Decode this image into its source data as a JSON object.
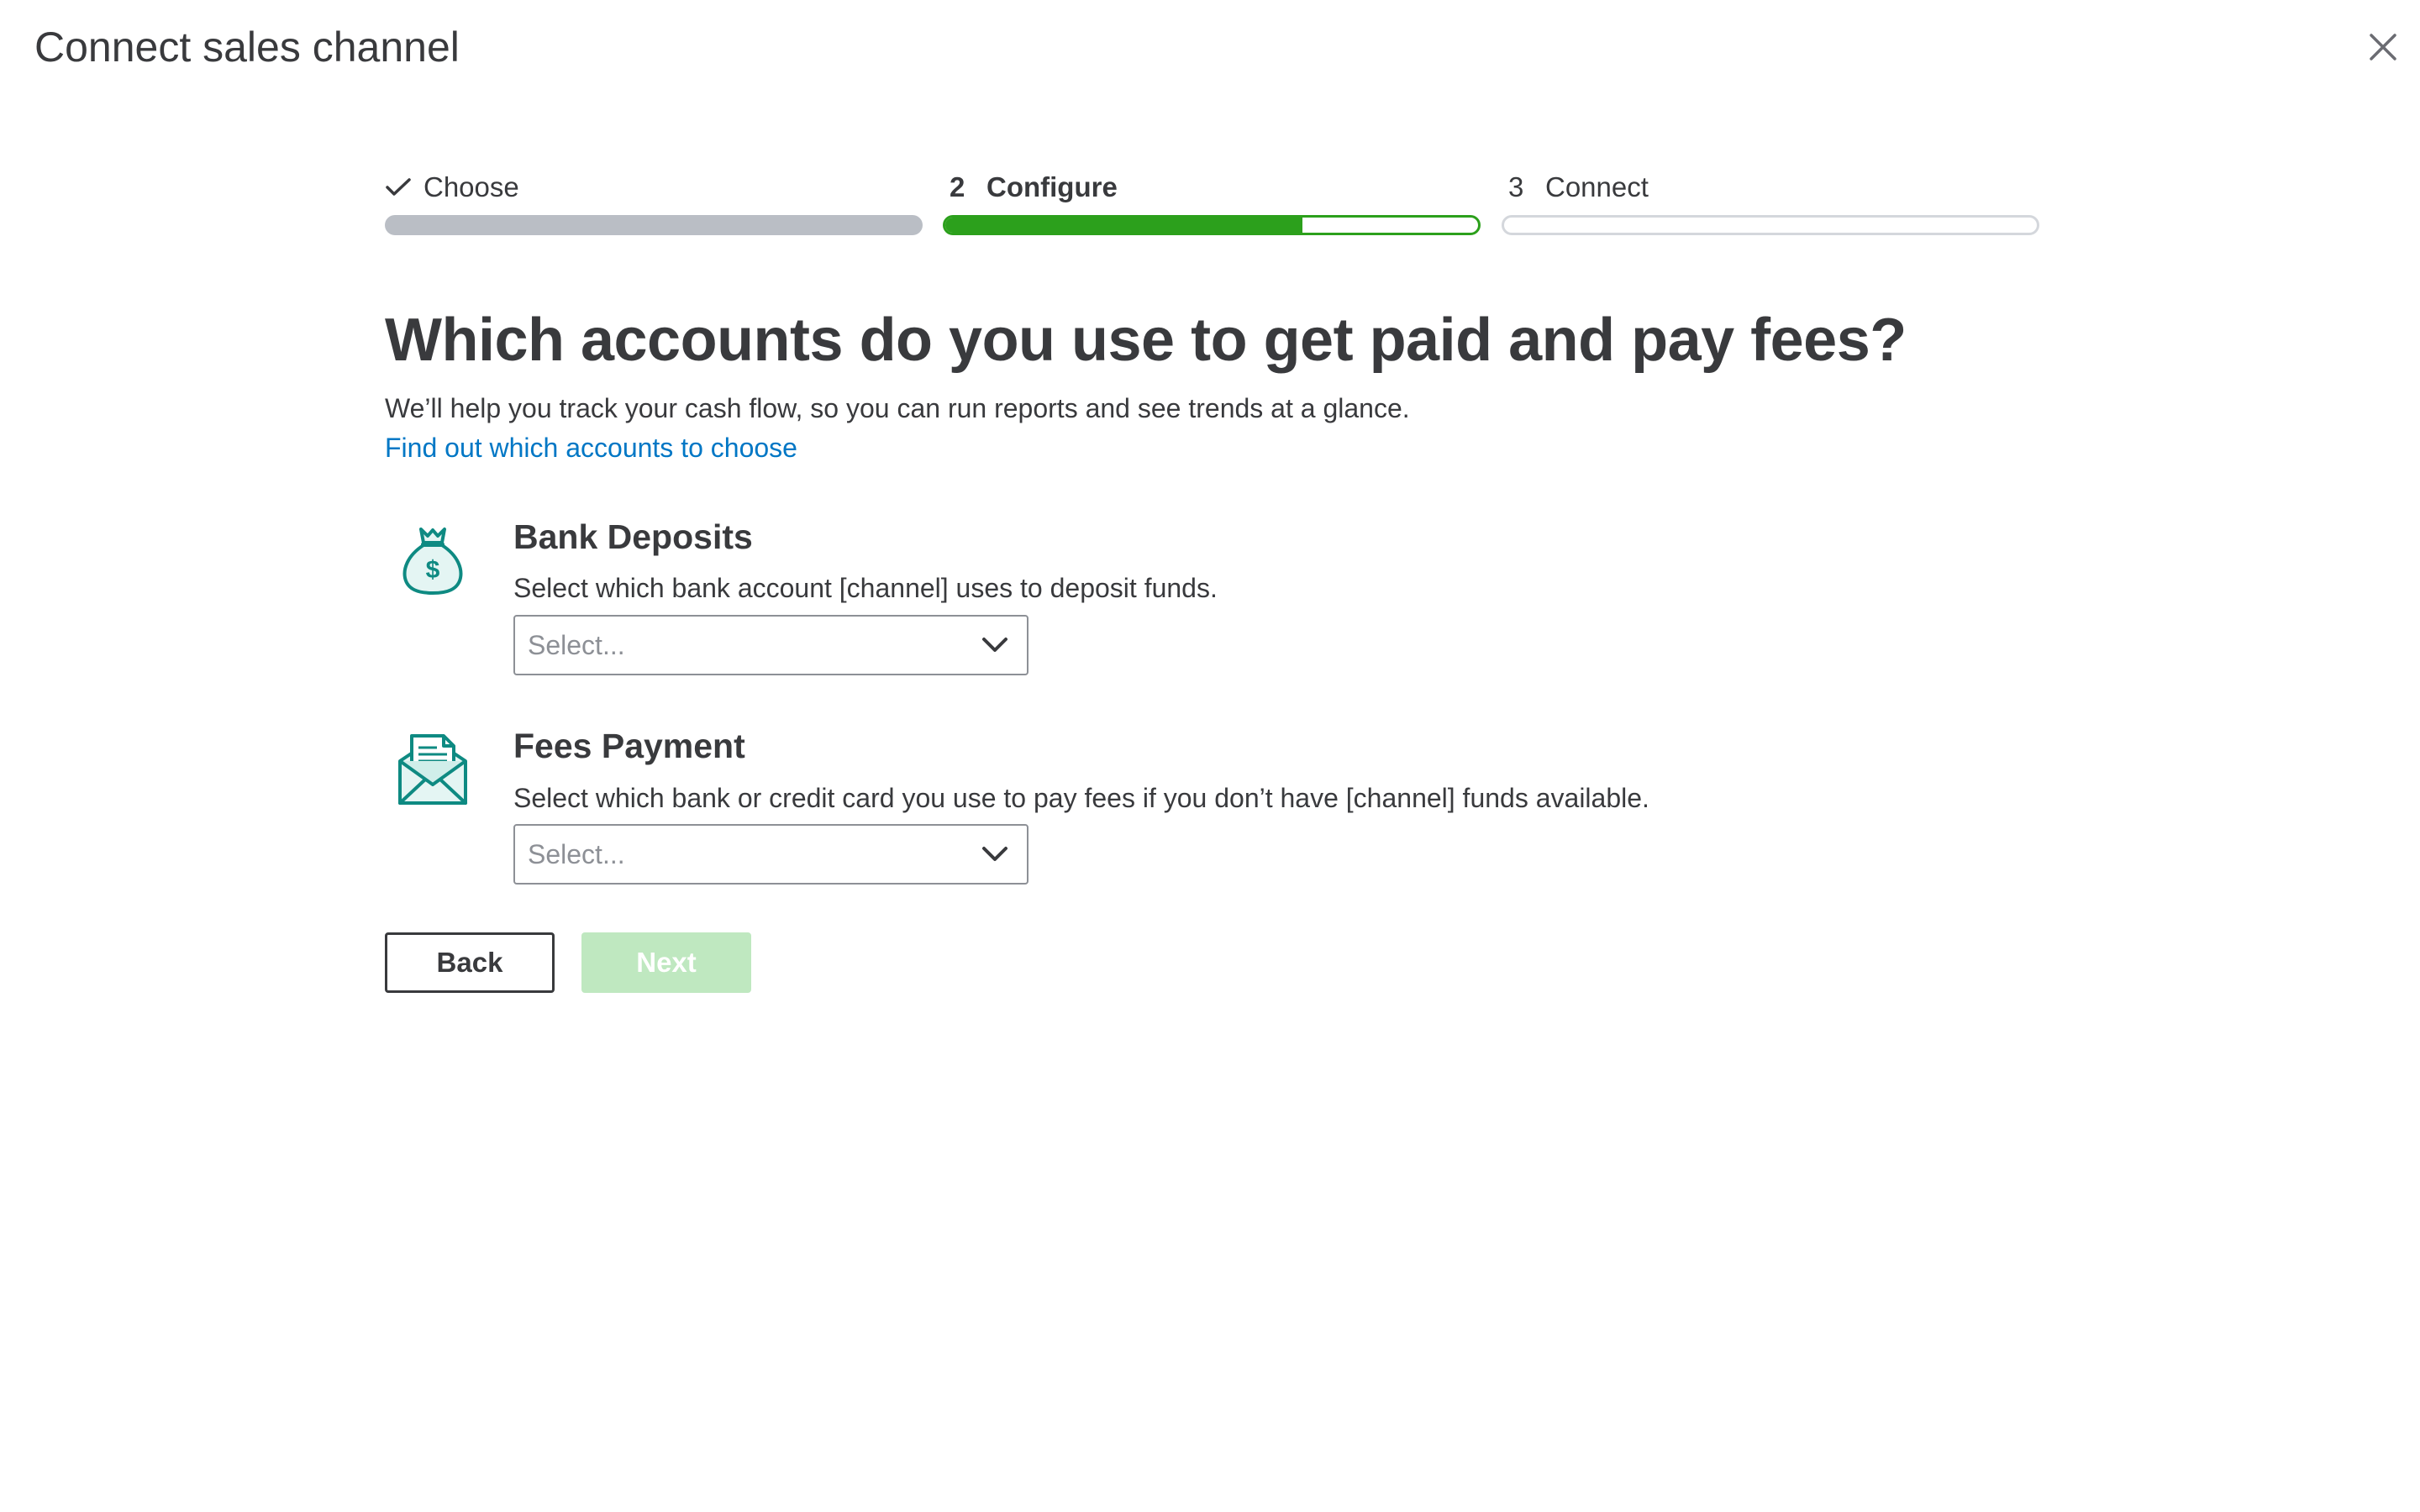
{
  "dialog": {
    "title": "Connect sales channel",
    "close_icon": "close-icon"
  },
  "stepper": {
    "steps": [
      {
        "number": "",
        "label": "Choose",
        "state": "complete",
        "icon": "checkmark-icon"
      },
      {
        "number": "2",
        "label": "Configure",
        "state": "active",
        "progress": 0.67
      },
      {
        "number": "3",
        "label": "Connect",
        "state": "pending"
      }
    ]
  },
  "main": {
    "headline": "Which accounts do you use to get paid and pay fees?",
    "subtext": "We’ll help you track your cash flow, so you can run reports and see trends at a glance.",
    "help_link": "Find out which accounts to choose"
  },
  "sections": [
    {
      "icon": "money-bag-icon",
      "title": "Bank Deposits",
      "description": "Select which bank account [channel] uses to deposit funds.",
      "select_placeholder": "Select..."
    },
    {
      "icon": "invoice-envelope-icon",
      "title": "Fees Payment",
      "description": "Select which bank or credit card you use to pay fees if you don’t have [channel] funds available.",
      "select_placeholder": "Select..."
    }
  ],
  "buttons": {
    "back_label": "Back",
    "next_label": "Next"
  },
  "colors": {
    "accent_green": "#2ca01c",
    "link_blue": "#0077c5",
    "text": "#393a3d",
    "complete_bar": "#babec5",
    "disabled_button": "#bfe8c0",
    "icon_teal": "#0e8a82"
  }
}
